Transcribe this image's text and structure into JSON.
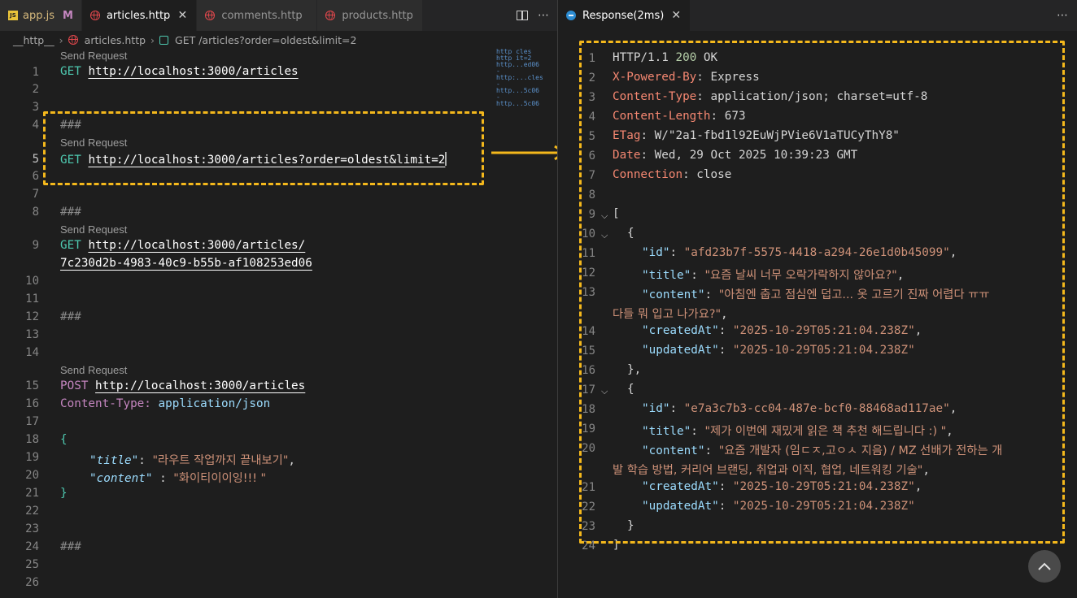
{
  "left": {
    "tabs": [
      {
        "label": "app.js",
        "mark": "M"
      },
      {
        "label": "articles.http"
      },
      {
        "label": "comments.http"
      },
      {
        "label": "products.http"
      }
    ],
    "breadcrumb": [
      "__http__",
      "articles.http",
      "GET /articles?order=oldest&limit=2"
    ],
    "code_lens": "Send Request",
    "line_numbers": [
      "1",
      "2",
      "3",
      "4",
      "5",
      "6",
      "7",
      "8",
      "9",
      "10",
      "11",
      "12",
      "13",
      "14",
      "15",
      "16",
      "17",
      "18",
      "19",
      "20",
      "21",
      "22",
      "23",
      "24",
      "25",
      "26"
    ],
    "requests": {
      "r1_method": "GET",
      "r1_url": "http://localhost:3000/articles",
      "sep": "###",
      "r2_method": "GET",
      "r2_url": "http://localhost:3000/articles?order=oldest&limit=2",
      "r3_method": "GET",
      "r3_url_a": "http://localhost:3000/articles/",
      "r3_url_b": "7c230d2b-4983-40c9-b55b-af108253ed06",
      "r4_method": "POST",
      "r4_url": "http://localhost:3000/articles",
      "r4_header_name": "Content-Type:",
      "r4_header_value": "application/json",
      "body_open": "{",
      "body_close": "}",
      "body_key1": "\"title\"",
      "body_val1": "\"라우트 작업까지 끝내보기\"",
      "body_key2": "\"content\"",
      "body_val2": "\"화이티이이잉!!! \""
    },
    "minimap": [
      "http  cles",
      "http  it=2",
      "http...ed06",
      "-",
      "http:...cles",
      "-",
      "http...5c06",
      "-",
      "http...5c06"
    ]
  },
  "right": {
    "tab_label": "Response(2ms)",
    "line_numbers": [
      "1",
      "2",
      "3",
      "4",
      "5",
      "6",
      "7",
      "8",
      "9",
      "10",
      "11",
      "12",
      "13",
      "",
      "14",
      "15",
      "16",
      "17",
      "18",
      "19",
      "20",
      "",
      "21",
      "22",
      "23",
      "24"
    ],
    "status_line": {
      "proto": "HTTP/1.1",
      "code": "200",
      "text": "OK"
    },
    "headers": [
      {
        "name": "X-Powered-By",
        "value": "Express"
      },
      {
        "name": "Content-Type",
        "value": "application/json; charset=utf-8"
      },
      {
        "name": "Content-Length",
        "value": "673"
      },
      {
        "name": "ETag",
        "value": "W/\"2a1-fbd1l92EuWjPVie6V1aTUCyThY8\""
      },
      {
        "name": "Date",
        "value": "Wed, 29 Oct 2025 10:39:23 GMT"
      },
      {
        "name": "Connection",
        "value": "close"
      }
    ],
    "articles": [
      {
        "id": "\"afd23b7f-5575-4418-a294-26e1d0b45099\"",
        "title": "\"요즘 날씨 너무 오락가락하지 않아요?\"",
        "content_a": "\"아침엔 춥고 점심엔 덥고... 옷 고르기 진짜 어렵다 ㅠㅠ",
        "content_b": "다들 뭐 입고 나가요?\"",
        "createdAt": "\"2025-10-29T05:21:04.238Z\"",
        "updatedAt": "\"2025-10-29T05:21:04.238Z\""
      },
      {
        "id": "\"e7a3c7b3-cc04-487e-bcf0-88468ad117ae\"",
        "title": "\"제가 이번에 재밌게 읽은 책 추천 해드립니다 :) \"",
        "content_a": "\"요즘 개발자 (임ㄷㅈ,고ㅇㅅ 지음) / MZ 선배가 전하는 개",
        "content_b": "발 학습 방법, 커리어 브랜딩, 취업과 이직, 협업, 네트워킹 기술\"",
        "createdAt": "\"2025-10-29T05:21:04.238Z\"",
        "updatedAt": "\"2025-10-29T05:21:04.238Z\""
      }
    ],
    "keys": {
      "id": "\"id\"",
      "title": "\"title\"",
      "content": "\"content\"",
      "createdAt": "\"createdAt\"",
      "updatedAt": "\"updatedAt\""
    },
    "punct": {
      "open_bracket": "[",
      "close_bracket": "]",
      "open_obj": "{",
      "close_obj_comma": "},",
      "close_obj": "}"
    }
  },
  "colors": {
    "highlight": "#f4b81c",
    "accent": "#4ec9b0"
  }
}
